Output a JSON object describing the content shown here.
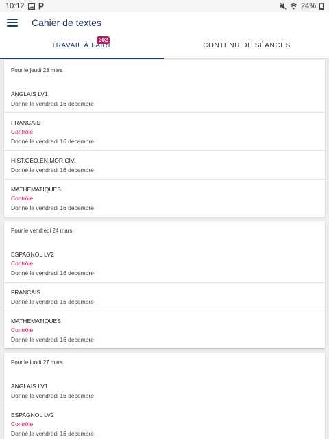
{
  "status_bar": {
    "time": "10:12",
    "battery": "24%",
    "icons": [
      "image-icon",
      "p-icon",
      "mute-icon",
      "wifi-icon",
      "battery-icon"
    ]
  },
  "app_bar": {
    "menu_icon": "menu-icon",
    "title": "Cahier de textes"
  },
  "tabs": [
    {
      "label": "TRAVAIL À FAIRE",
      "badge": "302",
      "active": true
    },
    {
      "label": "CONTENU DE SÉANCES",
      "active": false
    }
  ],
  "colors": {
    "primary": "#1a3b6e",
    "accent": "#c2185b",
    "background": "#efefef"
  },
  "days": [
    {
      "header": "Pour le jeudi 23 mars",
      "items": [
        {
          "subject": "ANGLAIS LV1",
          "tag": "",
          "given": "Donné le vendredi 16 décembre"
        },
        {
          "subject": "FRANCAIS",
          "tag": "Contrôle",
          "given": "Donné le vendredi 16 décembre"
        },
        {
          "subject": "HIST.GEO.EN.MOR.CIV.",
          "tag": "",
          "given": "Donné le vendredi 16 décembre"
        },
        {
          "subject": "MATHEMATIQUES",
          "tag": "Contrôle",
          "given": "Donné le vendredi 16 décembre"
        }
      ]
    },
    {
      "header": "Pour le vendredi 24 mars",
      "items": [
        {
          "subject": "ESPAGNOL LV2",
          "tag": "Contrôle",
          "given": "Donné le vendredi 16 décembre"
        },
        {
          "subject": "FRANCAIS",
          "tag": "",
          "given": "Donné le vendredi 16 décembre"
        },
        {
          "subject": "MATHEMATIQUES",
          "tag": "Contrôle",
          "given": "Donné le vendredi 16 décembre"
        }
      ]
    },
    {
      "header": "Pour le lundi 27 mars",
      "items": [
        {
          "subject": "ANGLAIS LV1",
          "tag": "",
          "given": "Donné le vendredi 16 décembre"
        },
        {
          "subject": "ESPAGNOL LV2",
          "tag": "Contrôle",
          "given": "Donné le vendredi 16 décembre"
        }
      ]
    }
  ]
}
